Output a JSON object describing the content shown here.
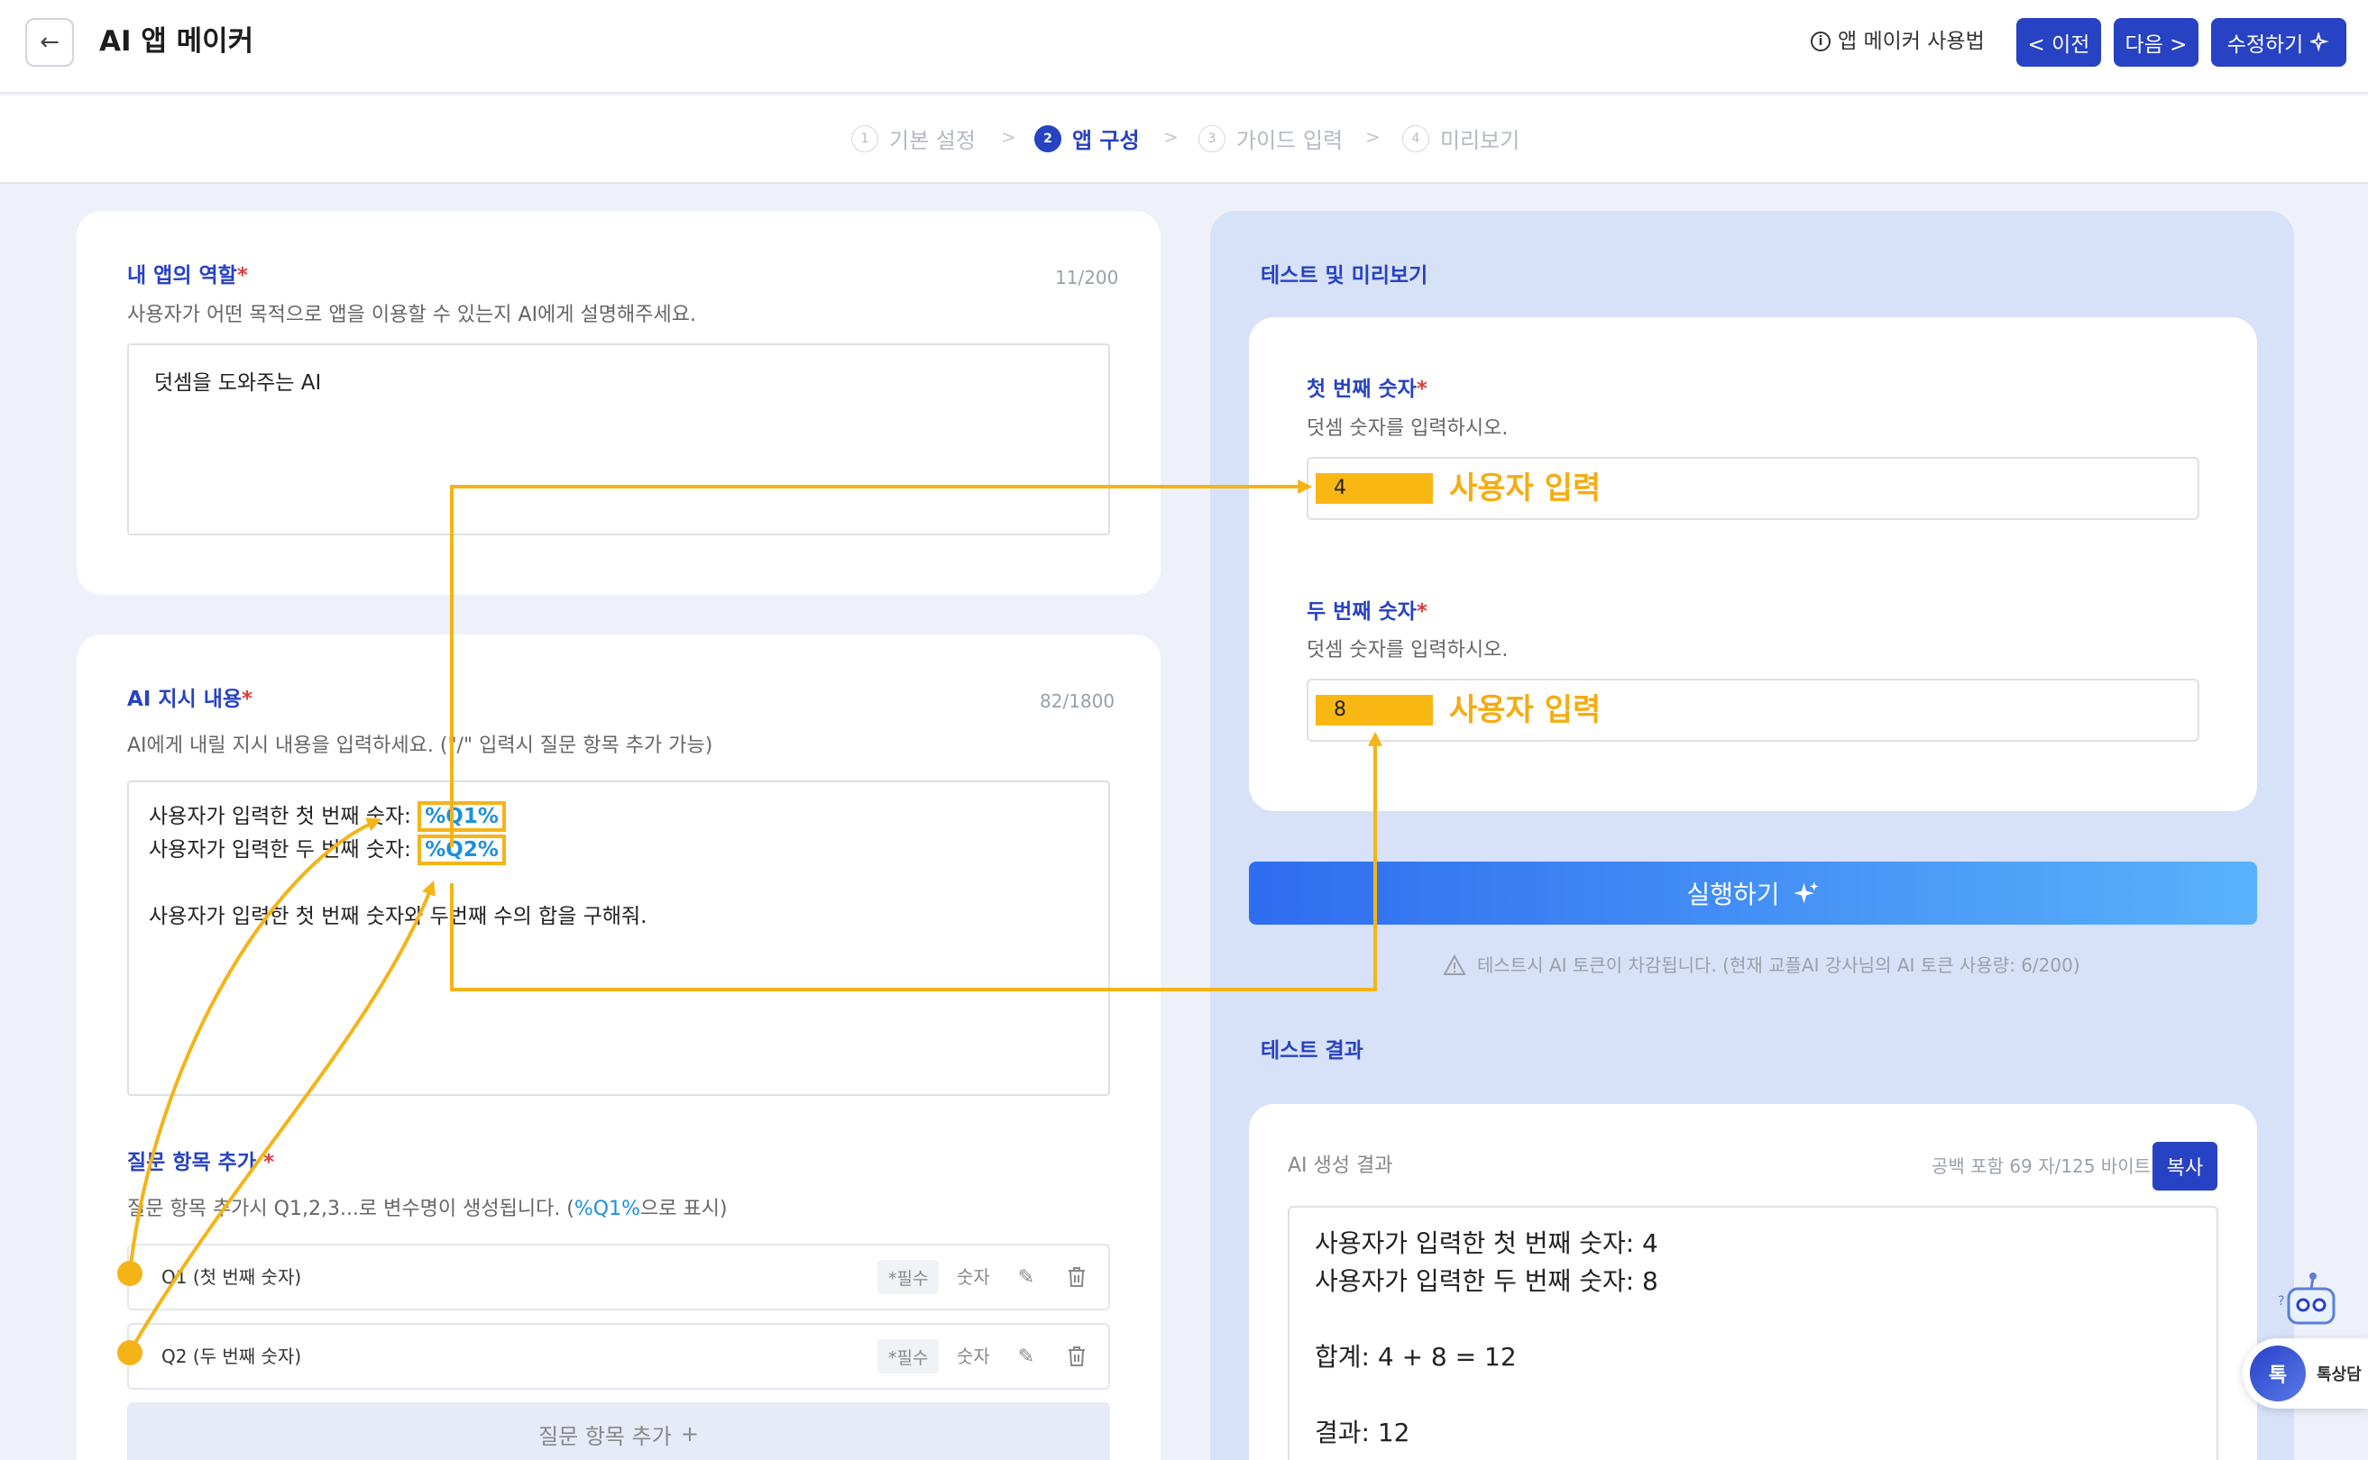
{
  "header": {
    "title": "AI 앱 메이커",
    "howto_label": "앱 메이커 사용법",
    "prev_label": "< 이전",
    "next_label": "다음 >",
    "edit_label": "수정하기"
  },
  "stepper": {
    "steps": [
      {
        "num": "1",
        "label": "기본 설정"
      },
      {
        "num": "2",
        "label": "앱 구성"
      },
      {
        "num": "3",
        "label": "가이드 입력"
      },
      {
        "num": "4",
        "label": "미리보기"
      }
    ]
  },
  "role": {
    "title": "내 앱의 역할",
    "counter": "11/200",
    "description": "사용자가 어떤 목적으로 앱을 이용할 수 있는지 AI에게 설명해주세요.",
    "value": "덧셈을 도와주는 AI"
  },
  "instructions": {
    "title": "AI 지시 내용",
    "counter": "82/1800",
    "description": "AI에게 내릴 지시 내용을 입력하세요. (\"/\" 입력시 질문 항목 추가 가능)",
    "line1_prefix": "사용자가 입력한 첫 번째 숫자: ",
    "line1_var": "%Q1%",
    "line2_prefix": "사용자가 입력한 두 번째 숫자: ",
    "line2_var": "%Q2%",
    "line3": "사용자가 입력한 첫 번째 숫자와 두번째 수의 합을 구해줘."
  },
  "questions": {
    "title": "질문 항목 추가",
    "desc_prefix": "질문 항목 추가시 Q1,2,3...로 변수명이 생성됩니다. (",
    "desc_var": "%Q1%",
    "desc_suffix": "으로 표시)",
    "items": [
      {
        "label": "Q1 (첫 번째 숫자)",
        "badge": "*필수",
        "type": "숫자"
      },
      {
        "label": "Q2 (두 번째 숫자)",
        "badge": "*필수",
        "type": "숫자"
      }
    ],
    "add_label": "질문 항목 추가"
  },
  "preview": {
    "title": "테스트 및 미리보기",
    "fields": [
      {
        "label": "첫 번째 숫자",
        "desc": "덧셈 숫자를 입력하시오.",
        "value": "4",
        "annotation": "사용자 입력"
      },
      {
        "label": "두 번째 숫자",
        "desc": "덧셈 숫자를 입력하시오.",
        "value": "8",
        "annotation": "사용자 입력"
      }
    ],
    "run_label": "실행하기",
    "warning": "테스트시 AI 토큰이 차감됩니다. (현재 교플AI 강사님의 AI 토큰 사용량: 6/200)"
  },
  "result": {
    "title": "테스트 결과",
    "card_label": "AI 생성 결과",
    "byte_count": "공백 포함 69 자/125 바이트",
    "copy_label": "복사",
    "lines": [
      "사용자가 입력한 첫 번째 숫자: 4",
      "사용자가 입력한 두 번째 숫자: 8",
      "",
      "합계: 4 + 8 = 12",
      "",
      "결과: 12"
    ]
  },
  "chat": {
    "label": "톡상담",
    "badge": "톡"
  },
  "colors": {
    "accent": "#2742c3",
    "annotation": "#f4b418",
    "variable": "#1e8fdc",
    "required": "#e23b3b"
  },
  "icons": [
    "arrow-left-icon",
    "info-icon",
    "sparkle-icon",
    "edit-icon",
    "trash-icon",
    "plus-icon",
    "warning-icon",
    "robot-icon"
  ]
}
